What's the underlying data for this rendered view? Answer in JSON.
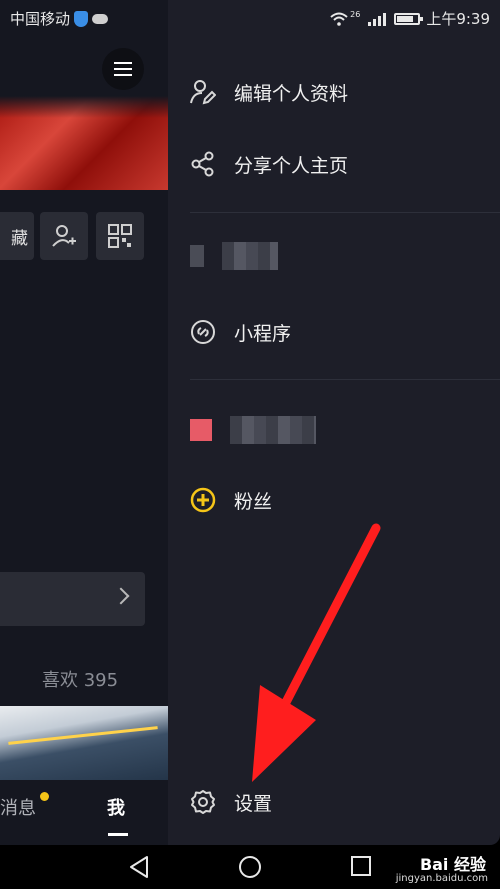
{
  "status_bar": {
    "carrier": "中国移动",
    "network_badge": "26",
    "time": "上午9:39"
  },
  "background_app": {
    "collect_tab_label": "藏",
    "likes_label": "喜欢 395",
    "nav": {
      "messages_label": "消息",
      "me_label": "我"
    },
    "accent_color": "#f5c518"
  },
  "drawer": {
    "items": [
      {
        "label": "编辑个人资料",
        "icon": "edit-profile-icon"
      },
      {
        "label": "分享个人主页",
        "icon": "share-icon"
      },
      {
        "label": "小程序",
        "icon": "mini-program-icon"
      },
      {
        "label": "粉丝",
        "icon": "fans-icon"
      },
      {
        "label": "设置",
        "icon": "settings-icon"
      }
    ],
    "background_color": "#1d1e28"
  },
  "annotation": {
    "arrow_color": "#ff1e1e"
  },
  "watermark": {
    "title": "Bai 经验",
    "url": "jingyan.baidu.com"
  }
}
